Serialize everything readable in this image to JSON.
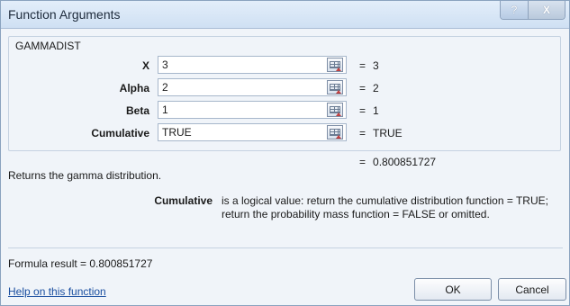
{
  "window": {
    "title": "Function Arguments",
    "help_glyph": "?",
    "close_glyph": "X"
  },
  "function_name": "GAMMADIST",
  "arguments": [
    {
      "label": "X",
      "value": "3",
      "result": "3"
    },
    {
      "label": "Alpha",
      "value": "2",
      "result": "2"
    },
    {
      "label": "Beta",
      "value": "1",
      "result": "1"
    },
    {
      "label": "Cumulative",
      "value": "TRUE",
      "result": "TRUE"
    }
  ],
  "equals_sign": "=",
  "total_result": "0.800851727",
  "description": "Returns the gamma distribution.",
  "argument_help": {
    "name": "Cumulative",
    "text": "is a logical value: return the cumulative distribution function = TRUE; return the probability mass function = FALSE or omitted."
  },
  "formula_result": "Formula result =  0.800851727",
  "help_link": "Help on this function",
  "buttons": {
    "ok": "OK",
    "cancel": "Cancel"
  },
  "colors": {
    "dialog_bg": "#f0f4f9",
    "link": "#1b4fa0",
    "border": "#8aa3bf"
  }
}
